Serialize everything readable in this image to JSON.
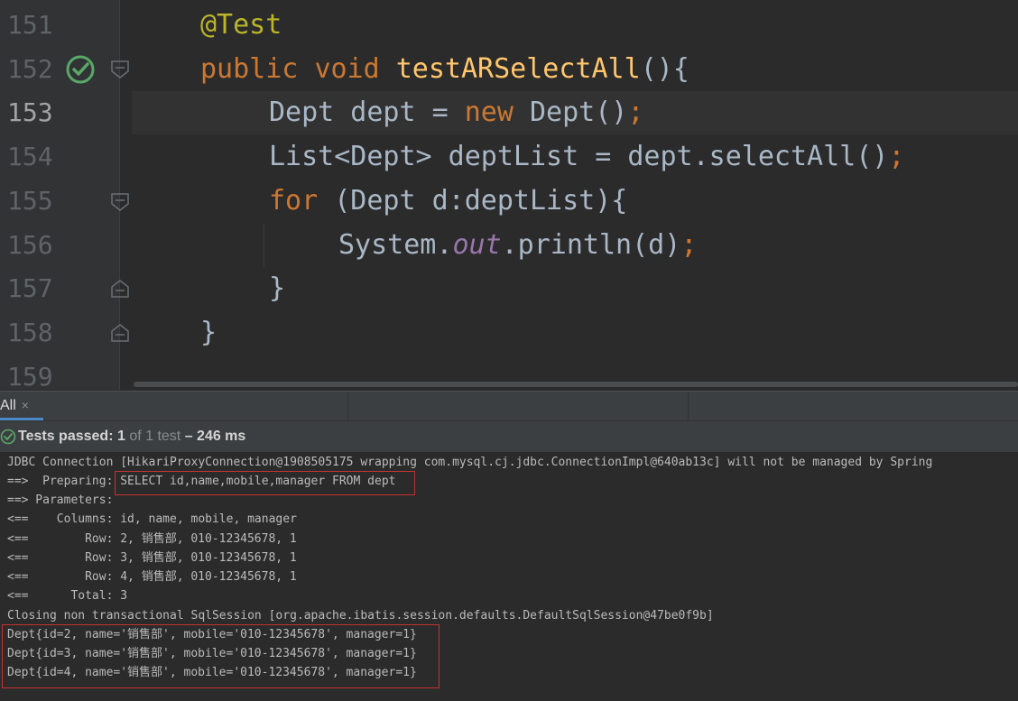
{
  "editor": {
    "line_numbers": [
      "151",
      "152",
      "153",
      "154",
      "155",
      "156",
      "157",
      "158",
      "159"
    ],
    "lines": {
      "l151": {
        "ann": "@Test"
      },
      "l152": {
        "kw1": "public",
        "kw2": "void",
        "fn": "testARSelectAll",
        "rest": "(){"
      },
      "l153": {
        "a": "Dept dept = ",
        "kw": "new",
        "b": " Dept()",
        "semi": ";"
      },
      "l154": {
        "a": "List<Dept> deptList = dept.selectAll()",
        "semi": ";"
      },
      "l155": {
        "kw": "for",
        "a": " (Dept d:deptList){"
      },
      "l156": {
        "a": "System.",
        "field": "out",
        "b": ".println(d)",
        "semi": ";"
      },
      "l157": {
        "a": "}"
      },
      "l158": {
        "a": "}"
      }
    },
    "run_icon": "test-passed-check-icon"
  },
  "tool_window": {
    "tab_label": "All",
    "tab_close": "×",
    "status": {
      "icon": "check-circle-icon",
      "passed_label": "Tests passed: ",
      "passed_count": "1",
      "of_text": " of 1 test",
      "duration": " – 246 ms"
    }
  },
  "console": {
    "lines": [
      "JDBC Connection [HikariProxyConnection@1908505175 wrapping com.mysql.cj.jdbc.ConnectionImpl@640ab13c] will not be managed by Spring",
      "==>  Preparing: SELECT id,name,mobile,manager FROM dept",
      "==> Parameters: ",
      "<==    Columns: id, name, mobile, manager",
      "<==        Row: 2, 销售部, 010-12345678, 1",
      "<==        Row: 3, 销售部, 010-12345678, 1",
      "<==        Row: 4, 销售部, 010-12345678, 1",
      "<==      Total: 3",
      "Closing non transactional SqlSession [org.apache.ibatis.session.defaults.DefaultSqlSession@47be0f9b]",
      "Dept{id=2, name='销售部', mobile='010-12345678', manager=1}",
      "Dept{id=3, name='销售部', mobile='010-12345678', manager=1}",
      "Dept{id=4, name='销售部', mobile='010-12345678', manager=1}"
    ]
  },
  "colors": {
    "highlight_border": "#c6332f",
    "keyword": "#cc7832",
    "annotation": "#bbb529",
    "function": "#ffc66d",
    "pass_green": "#59a869"
  }
}
